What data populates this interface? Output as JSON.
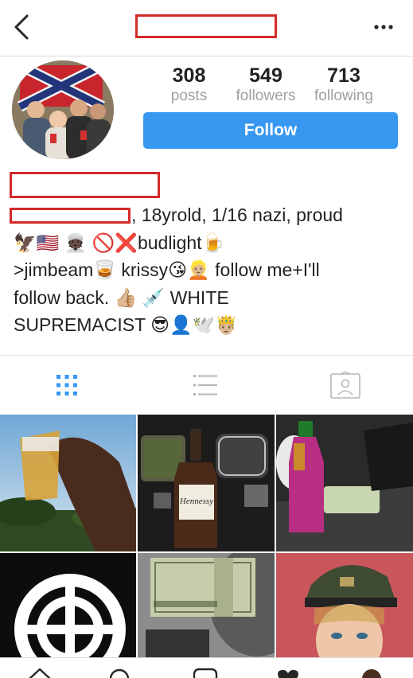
{
  "header": {
    "back_icon": "chevron-left-icon",
    "more_icon": "ellipsis-icon"
  },
  "profile": {
    "stats": [
      {
        "count": "308",
        "label": "posts"
      },
      {
        "count": "549",
        "label": "followers"
      },
      {
        "count": "713",
        "label": "following"
      }
    ],
    "follow_label": "Follow",
    "bio": {
      "line1": ", 18yrold, 1/16 nazi, proud",
      "line2": "🦅🇺🇸 👳🏿 🚫❌budlight🍺",
      "line3": ">jimbeam🥃 krissy😘👱🏼 follow me+I'll",
      "line4": "follow back. 👍🏼 💉 WHITE",
      "line5": "SUPREMACIST 😎👤🕊️🤴🏼"
    }
  },
  "tabs": [
    {
      "icon": "grid-icon",
      "active": true
    },
    {
      "icon": "list-icon",
      "active": false
    },
    {
      "icon": "tagged-icon",
      "active": false
    }
  ],
  "photos_text": {
    "bottle_label": "Hennessy"
  },
  "colors": {
    "accent": "#3897f0",
    "redaction": "#d42a2a",
    "tab_active": "#3897f0",
    "tab_inactive": "#b5b5b5"
  }
}
